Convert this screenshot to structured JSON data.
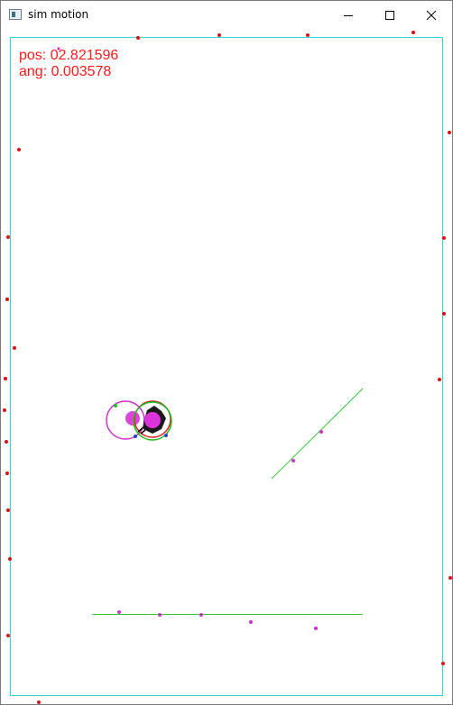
{
  "window": {
    "title": "sim motion",
    "icon": "app-window-icon"
  },
  "caption_buttons": {
    "minimize_icon": "minimize-icon",
    "maximize_icon": "maximize-icon",
    "close_icon": "close-icon"
  },
  "readouts": {
    "pos": "pos: 02.821596",
    "ang": "ang: 0.003578"
  },
  "colors": {
    "boundary": "#33d6d6",
    "readout_text": "#ff1a1a",
    "boundary_dots": "#dd1111",
    "track_lines": "#33cc33",
    "markers": "#cc33cc",
    "body_ring_green": "#22bb22",
    "body_ring_red": "#dd2222",
    "body_ring_magenta": "#cc33cc",
    "joint_blue": "#2244cc"
  }
}
